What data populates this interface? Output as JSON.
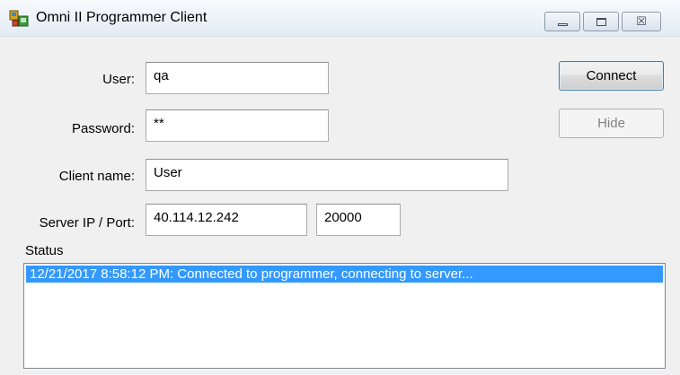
{
  "window": {
    "title": "Omni II Programmer Client"
  },
  "caption_buttons": {
    "minimize_icon": "minimize-icon",
    "maximize_icon": "maximize-icon",
    "close_glyph": "☒"
  },
  "form": {
    "user_label": "User:",
    "user_value": "qa",
    "password_label": "Password:",
    "password_value": "**",
    "client_name_label": "Client name:",
    "client_name_value": "User",
    "server_label": "Server IP / Port:",
    "server_ip_value": "40.114.12.242",
    "server_port_value": "20000"
  },
  "buttons": {
    "connect_label": "Connect",
    "hide_label": "Hide"
  },
  "status": {
    "label": "Status",
    "items": [
      "12/21/2017 8:58:12 PM: Connected to programmer, connecting to server..."
    ]
  },
  "colors": {
    "selection": "#3399ff",
    "window_bg": "#f0f0f0"
  }
}
